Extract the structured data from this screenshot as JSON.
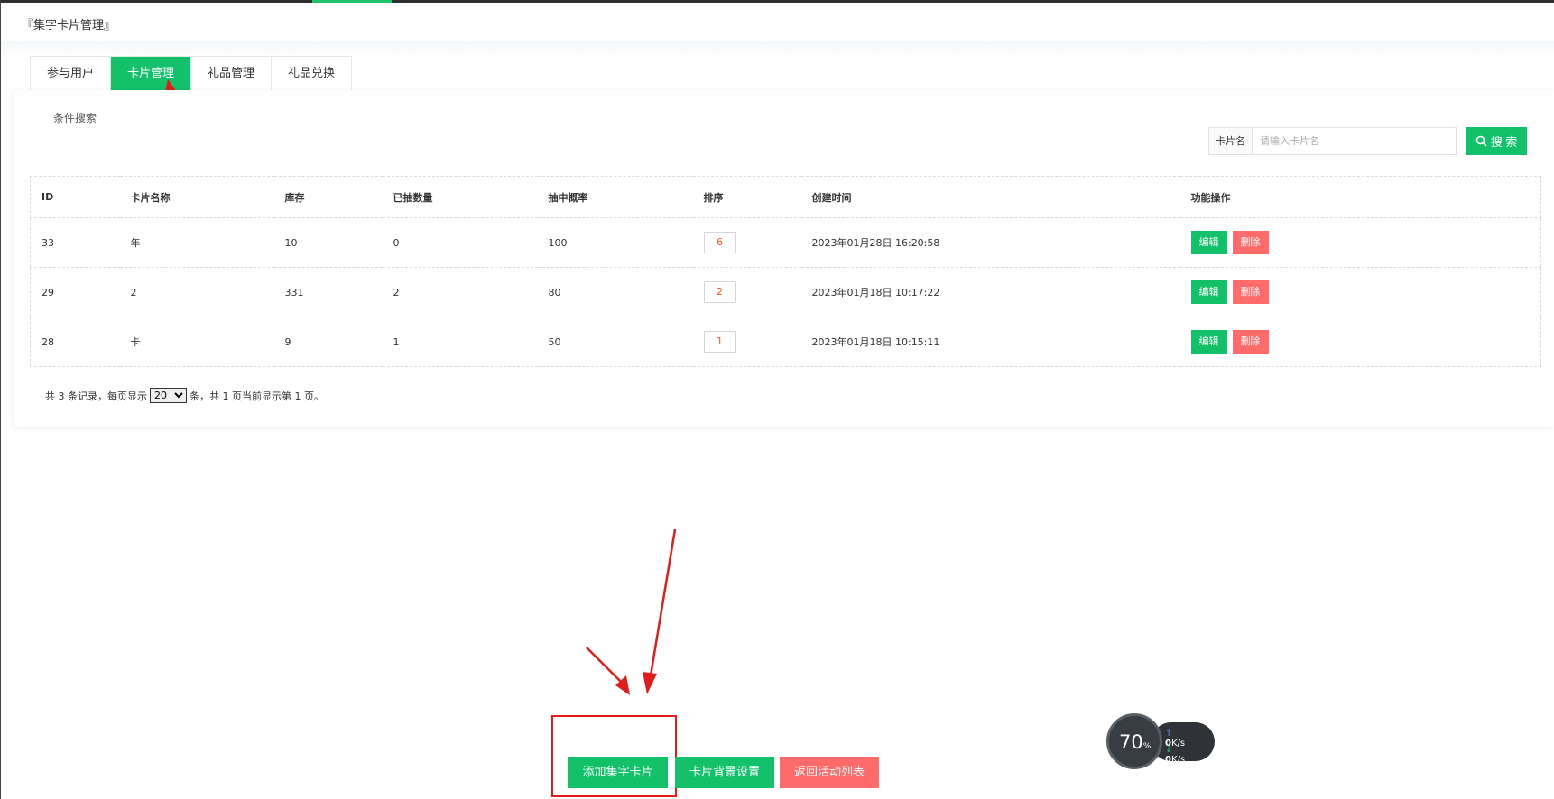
{
  "page_title": "『集字卡片管理』",
  "tabs": [
    {
      "label": "参与用户",
      "active": false
    },
    {
      "label": "卡片管理",
      "active": true
    },
    {
      "label": "礼品管理",
      "active": false
    },
    {
      "label": "礼品兑换",
      "active": false
    }
  ],
  "search": {
    "section_label": "条件搜索",
    "field_label": "卡片名",
    "placeholder": "请输入卡片名",
    "button_label": "搜 索"
  },
  "table": {
    "columns": [
      "ID",
      "卡片名称",
      "库存",
      "已抽数量",
      "抽中概率",
      "排序",
      "创建时间",
      "功能操作"
    ],
    "rows": [
      {
        "id": "33",
        "name": "年",
        "stock": "10",
        "drawn": "0",
        "prob": "100",
        "sort": "6",
        "created": "2023年01月28日 16:20:58"
      },
      {
        "id": "29",
        "name": "2",
        "stock": "331",
        "drawn": "2",
        "prob": "80",
        "sort": "2",
        "created": "2023年01月18日 10:17:22"
      },
      {
        "id": "28",
        "name": "卡",
        "stock": "9",
        "drawn": "1",
        "prob": "50",
        "sort": "1",
        "created": "2023年01月18日 10:15:11"
      }
    ],
    "edit_label": "编辑",
    "delete_label": "删除"
  },
  "pager": {
    "prefix": "共 3 条记录，每页显示",
    "page_size": "20",
    "suffix": "条，共 1 页当前显示第 1 页。"
  },
  "actions": {
    "add_card": "添加集字卡片",
    "card_bg": "卡片背景设置",
    "back_list": "返回活动列表"
  },
  "speed_widget": {
    "percent": "70",
    "percent_unit": "%",
    "upload_value": "0",
    "download_value": "0",
    "unit": "K/s"
  },
  "colors": {
    "accent_green": "#12c16a",
    "danger_red": "#ff6b6b",
    "sort_text": "#ff5722",
    "annotation_red": "#e21b1b"
  }
}
